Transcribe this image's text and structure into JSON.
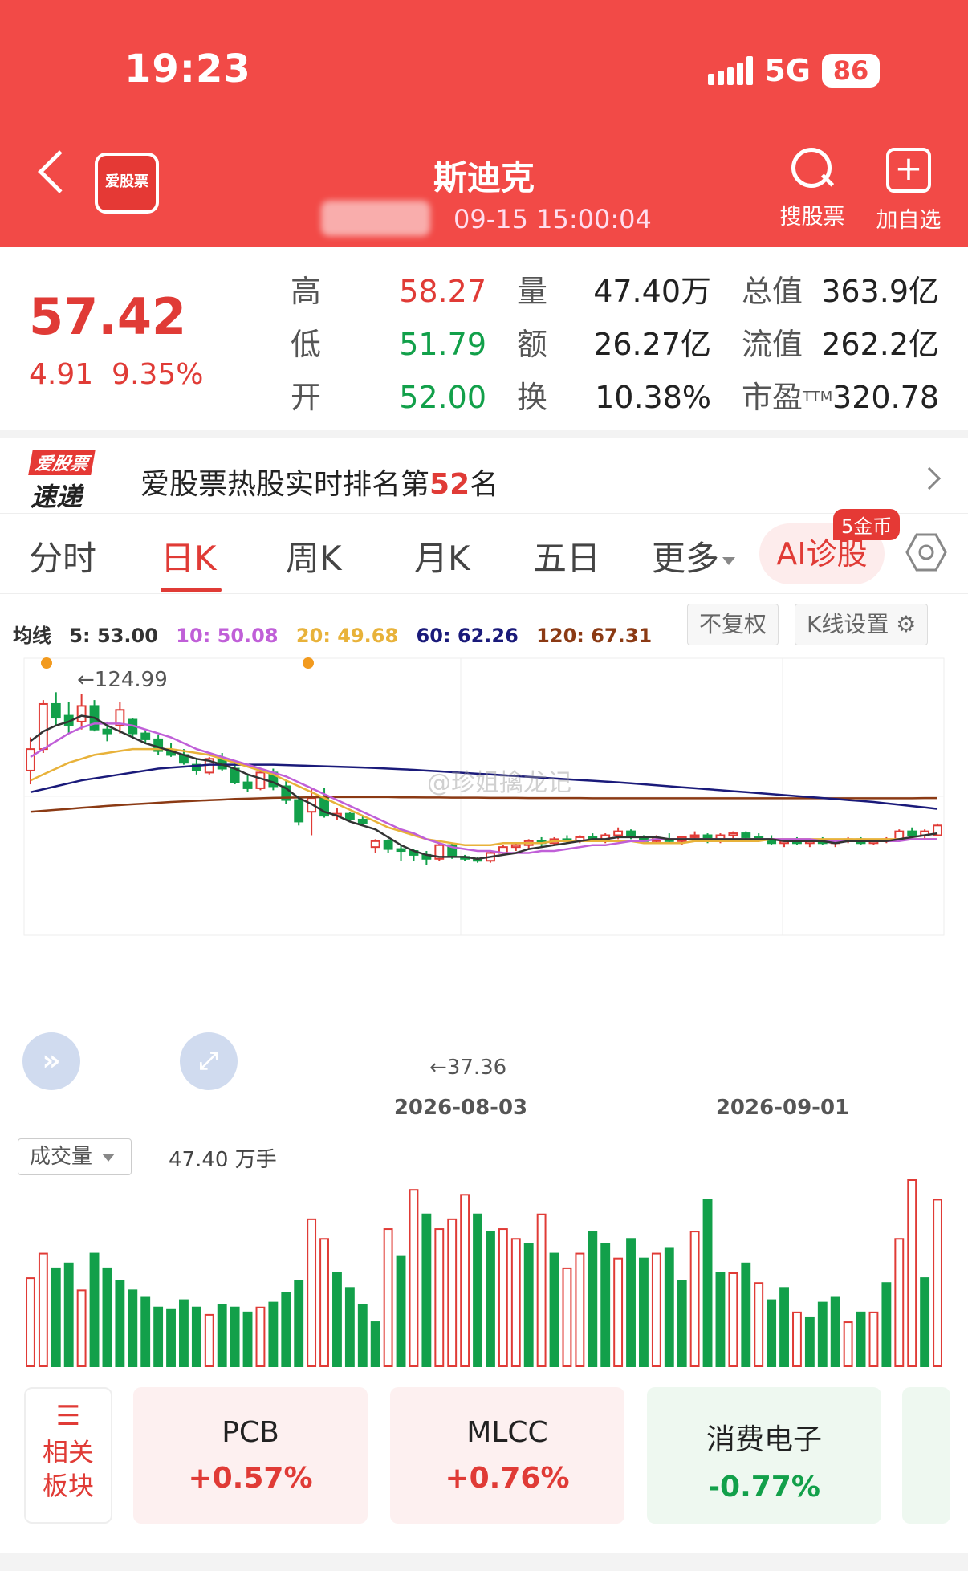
{
  "status": {
    "time": "19:23",
    "network": "5G",
    "battery": "86"
  },
  "header": {
    "app_logo": "爱股票",
    "stock_name": "斯迪克",
    "timestamp": "09-15 15:00:04",
    "search_label": "搜股票",
    "add_label": "加自选"
  },
  "quote": {
    "price": "57.42",
    "change": "4.91",
    "change_pct": "9.35%",
    "rows": [
      {
        "l1": "高",
        "v1": "58.27",
        "l2": "量",
        "v2": "47.40万",
        "l3": "总值",
        "v3": "363.9亿"
      },
      {
        "l1": "低",
        "v1": "51.79",
        "l2": "额",
        "v2": "26.27亿",
        "l3": "流值",
        "v3": "262.2亿"
      },
      {
        "l1": "开",
        "v1": "52.00",
        "l2": "换",
        "v2": "10.38%",
        "l3": "市盈",
        "v3": "320.78"
      }
    ],
    "ttm": "TTM"
  },
  "rank": {
    "logo_top": "爱股票",
    "logo_bottom": "速递",
    "text": "爱股票热股实时排名第",
    "num": "52",
    "suffix": "名"
  },
  "tabs": {
    "t1": "分时",
    "t2": "日K",
    "t3": "周K",
    "t4": "月K",
    "t5": "五日",
    "t6": "更多",
    "ai": "AI诊股",
    "coin": "5金币"
  },
  "ma": {
    "label": "均线",
    "ma5": "5: 53.00",
    "ma10": "10: 50.08",
    "ma20": "20: 49.68",
    "ma60": "60: 62.26",
    "ma120": "120: 67.31",
    "colors": {
      "ma5": "#333333",
      "ma10": "#c05fd8",
      "ma20": "#e8b23a",
      "ma60": "#1a1a7a",
      "ma120": "#8b3a14"
    },
    "no_adjust": "不复权",
    "k_settings": "K线设置"
  },
  "chart_data": {
    "type": "candlestick",
    "high_label": "←124.99",
    "low_label": "←37.36",
    "x_ticks": [
      "2026-08-03",
      "2026-09-01"
    ],
    "watermark": "@珍姐擒龙记",
    "ohlc": [
      [
        85,
        102,
        78,
        96
      ],
      [
        96,
        121,
        94,
        119
      ],
      [
        119,
        125,
        108,
        112
      ],
      [
        113,
        120,
        104,
        108
      ],
      [
        110,
        124,
        106,
        118
      ],
      [
        118,
        121,
        105,
        106
      ],
      [
        106,
        110,
        100,
        104
      ],
      [
        108,
        120,
        104,
        116
      ],
      [
        111,
        112,
        101,
        104
      ],
      [
        104,
        106,
        99,
        101
      ],
      [
        101,
        103,
        93,
        95
      ],
      [
        95,
        99,
        92,
        93
      ],
      [
        93,
        96,
        88,
        89
      ],
      [
        88,
        91,
        83,
        85
      ],
      [
        84,
        92,
        83,
        91
      ],
      [
        91,
        94,
        85,
        86
      ],
      [
        86,
        89,
        78,
        79
      ],
      [
        79,
        83,
        74,
        76
      ],
      [
        76,
        86,
        75,
        84
      ],
      [
        84,
        86,
        75,
        77
      ],
      [
        77,
        80,
        68,
        70
      ],
      [
        70,
        72,
        57,
        59
      ],
      [
        64,
        76,
        52,
        71
      ],
      [
        71,
        76,
        61,
        62
      ],
      [
        62,
        66,
        60,
        63
      ],
      [
        63,
        64,
        59,
        60
      ],
      [
        60,
        62,
        57,
        58
      ],
      [
        46,
        50,
        43,
        49
      ],
      [
        49,
        50,
        43,
        45
      ],
      [
        45,
        47,
        39,
        44
      ],
      [
        44,
        45,
        39,
        42
      ],
      [
        42,
        44,
        37,
        40
      ],
      [
        40,
        48,
        39,
        47
      ],
      [
        47,
        48,
        40,
        41
      ],
      [
        41,
        42,
        39,
        40
      ],
      [
        40,
        41,
        38,
        39
      ],
      [
        39,
        44,
        38,
        43
      ],
      [
        43,
        47,
        42,
        46
      ],
      [
        46,
        48,
        44,
        47
      ],
      [
        47,
        50,
        45,
        49
      ],
      [
        49,
        51,
        46,
        48
      ],
      [
        48,
        51,
        47,
        50
      ],
      [
        50,
        52,
        48,
        49
      ],
      [
        49,
        52,
        48,
        51
      ],
      [
        51,
        53,
        49,
        50
      ],
      [
        50,
        53,
        48,
        52
      ],
      [
        52,
        56,
        50,
        54
      ],
      [
        54,
        55,
        50,
        51
      ],
      [
        51,
        52,
        48,
        49
      ],
      [
        49,
        52,
        48,
        50
      ],
      [
        50,
        53,
        48,
        49
      ],
      [
        49,
        51,
        47,
        51
      ],
      [
        51,
        54,
        49,
        52
      ],
      [
        52,
        53,
        48,
        49
      ],
      [
        49,
        53,
        48,
        52
      ],
      [
        52,
        54,
        50,
        53
      ],
      [
        53,
        54,
        50,
        51
      ],
      [
        51,
        53,
        49,
        50
      ],
      [
        50,
        52,
        47,
        48
      ],
      [
        48,
        50,
        46,
        49
      ],
      [
        49,
        51,
        47,
        48
      ],
      [
        48,
        50,
        46,
        49
      ],
      [
        49,
        51,
        47,
        48
      ],
      [
        48,
        50,
        46,
        49
      ],
      [
        49,
        51,
        48,
        50
      ],
      [
        50,
        51,
        47,
        48
      ],
      [
        48,
        50,
        47,
        49
      ],
      [
        49,
        51,
        48,
        50
      ],
      [
        50,
        55,
        49,
        54
      ],
      [
        54,
        56,
        51,
        52
      ],
      [
        52,
        55,
        50,
        54
      ],
      [
        52,
        58,
        52,
        57
      ]
    ],
    "ma5": [
      100,
      105,
      108,
      110,
      113,
      112,
      108,
      105,
      102,
      99,
      97,
      95,
      93,
      91,
      90,
      88,
      86,
      83,
      81,
      79,
      76,
      71,
      68,
      64,
      62,
      59,
      57,
      55,
      51,
      47,
      44,
      42,
      41,
      41,
      41,
      40,
      41,
      42,
      43,
      45,
      46,
      47,
      48,
      49,
      50,
      50,
      51,
      51,
      51,
      51,
      50,
      50,
      50,
      50,
      50,
      50,
      50,
      50,
      50,
      49,
      49,
      49,
      49,
      48,
      49,
      49,
      49,
      49,
      50,
      51,
      52,
      53
    ],
    "ma10": [
      92,
      96,
      100,
      104,
      107,
      109,
      109,
      109,
      108,
      106,
      104,
      102,
      99,
      96,
      94,
      92,
      90,
      88,
      86,
      84,
      82,
      79,
      76,
      73,
      70,
      67,
      64,
      61,
      58,
      55,
      53,
      50,
      48,
      46,
      45,
      44,
      44,
      43,
      43,
      43,
      44,
      44,
      45,
      46,
      47,
      47,
      48,
      49,
      49,
      50,
      50,
      50,
      50,
      50,
      50,
      50,
      50,
      50,
      50,
      50,
      50,
      50,
      49,
      49,
      49,
      49,
      49,
      49,
      49,
      50,
      50,
      50
    ],
    "ma20": [
      80,
      83,
      86,
      89,
      91,
      93,
      94,
      95,
      96,
      96,
      96,
      96,
      95,
      94,
      93,
      91,
      89,
      87,
      85,
      83,
      80,
      77,
      74,
      71,
      68,
      65,
      62,
      59,
      56,
      54,
      52,
      50,
      49,
      48,
      47,
      47,
      47,
      48,
      48,
      48,
      48,
      49,
      49,
      49,
      49,
      49,
      49,
      49,
      48,
      48,
      48,
      48,
      49,
      49,
      49,
      49,
      49,
      49,
      50,
      50,
      50,
      50,
      50,
      50,
      50,
      50,
      50,
      50,
      50,
      50,
      50,
      50
    ],
    "ma60": [
      74,
      75.5,
      77,
      78.5,
      80,
      81,
      82,
      83,
      84,
      85,
      86,
      86.5,
      87,
      87.5,
      88,
      88,
      88,
      88,
      88,
      88,
      87.8,
      87.6,
      87.4,
      87.2,
      87,
      86.8,
      86.6,
      86.3,
      86,
      85.7,
      85.4,
      85,
      84.6,
      84.2,
      83.8,
      83.4,
      83,
      82.6,
      82.2,
      81.8,
      81.4,
      81,
      80.6,
      80.2,
      79.8,
      79.4,
      79,
      78.5,
      78,
      77.5,
      77,
      76.5,
      76,
      75.5,
      75,
      74.5,
      74,
      73.5,
      73,
      72.5,
      72,
      71.5,
      71,
      70.5,
      70,
      69.5,
      69,
      68.3,
      67.6,
      66.9,
      66.2,
      65.5
    ],
    "ma120": [
      64,
      64.5,
      65,
      65.5,
      66,
      66.5,
      67,
      67.4,
      67.8,
      68.2,
      68.6,
      69,
      69.3,
      69.6,
      69.9,
      70.2,
      70.5,
      70.7,
      70.9,
      71.1,
      71.2,
      71.3,
      71.4,
      71.5,
      71.5,
      71.5,
      71.5,
      71.5,
      71.5,
      71.4,
      71.4,
      71.3,
      71.3,
      71.2,
      71.2,
      71.2,
      71.1,
      71.1,
      71.1,
      71,
      71,
      71,
      71,
      71,
      70.9,
      70.9,
      70.9,
      70.9,
      70.9,
      70.9,
      70.9,
      70.9,
      70.9,
      70.9,
      70.9,
      70.9,
      70.9,
      70.9,
      70.9,
      70.9,
      70.9,
      70.9,
      70.9,
      70.9,
      70.9,
      70.9,
      70.9,
      70.9,
      70.9,
      70.9,
      71,
      71
    ],
    "volume_unit": "万手",
    "volume": [
      36,
      46,
      40,
      42,
      31,
      46,
      40,
      35,
      31,
      28,
      24,
      23,
      27,
      24,
      21,
      25,
      24,
      22,
      24,
      26,
      30,
      35,
      60,
      52,
      38,
      32,
      25,
      18,
      56,
      45,
      72,
      62,
      56,
      60,
      70,
      62,
      55,
      56,
      52,
      50,
      62,
      46,
      40,
      46,
      55,
      50,
      44,
      52,
      44,
      46,
      48,
      35,
      55,
      68,
      38,
      38,
      42,
      34,
      27,
      32,
      22,
      20,
      26,
      28,
      18,
      22,
      22,
      34,
      52,
      76,
      36,
      68
    ],
    "volume_red": [
      1,
      1,
      0,
      0,
      1,
      0,
      0,
      0,
      0,
      0,
      0,
      0,
      0,
      0,
      1,
      0,
      0,
      0,
      1,
      0,
      0,
      0,
      1,
      1,
      0,
      0,
      0,
      0,
      1,
      0,
      1,
      0,
      1,
      1,
      1,
      0,
      0,
      1,
      1,
      0,
      1,
      0,
      1,
      1,
      0,
      0,
      1,
      0,
      0,
      1,
      0,
      0,
      1,
      0,
      0,
      1,
      0,
      1,
      0,
      0,
      1,
      0,
      0,
      0,
      1,
      0,
      1,
      0,
      1,
      1,
      0,
      1
    ]
  },
  "volume": {
    "dropdown": "成交量",
    "value": "47.40 万手"
  },
  "sectors": {
    "side": "相关板块",
    "items": [
      {
        "name": "PCB",
        "pct": "+0.57%"
      },
      {
        "name": "MLCC",
        "pct": "+0.76%"
      },
      {
        "name": "消费电子",
        "pct": "-0.77%"
      }
    ]
  }
}
